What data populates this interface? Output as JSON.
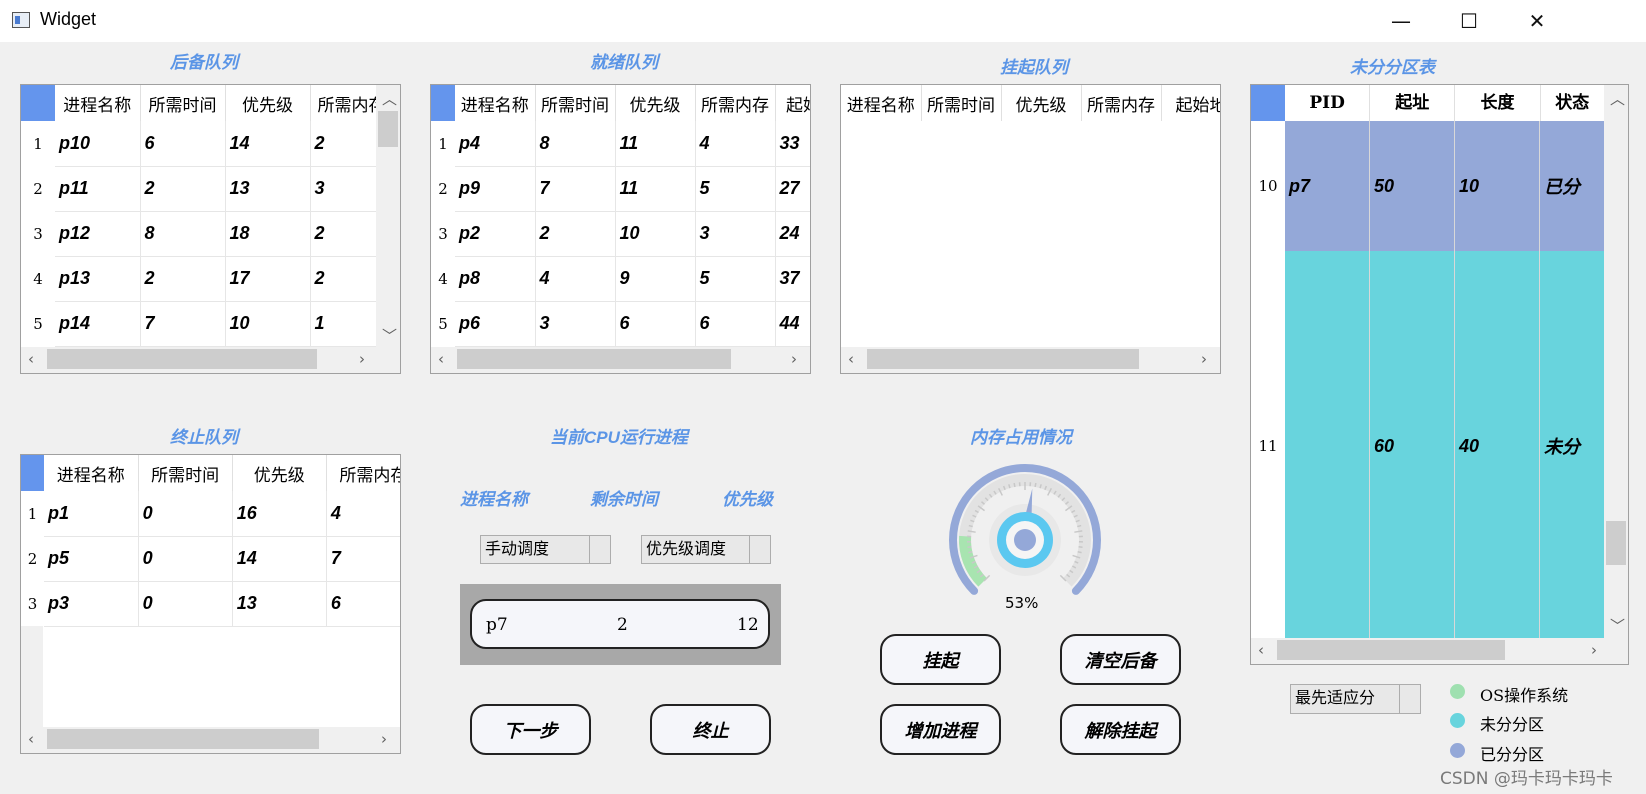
{
  "window": {
    "title": "Widget",
    "minimize": "—",
    "maximize": "☐",
    "close": "✕"
  },
  "labels": {
    "backup_queue": "后备队列",
    "ready_queue": "就绪队列",
    "suspend_queue": "挂起队列",
    "partition_table": "未分分区表",
    "terminated_queue": "终止队列",
    "cpu_process": "当前CPU运行进程",
    "memory_usage": "内存占用情况",
    "col_name": "进程名称",
    "col_remaining": "剩余时间",
    "col_priority": "优先级"
  },
  "backup_table": {
    "headers": [
      "进程名称",
      "所需时间",
      "优先级",
      "所需内存"
    ],
    "rows": [
      [
        "1",
        "p10",
        "6",
        "14",
        "2"
      ],
      [
        "2",
        "p11",
        "2",
        "13",
        "3"
      ],
      [
        "3",
        "p12",
        "8",
        "18",
        "2"
      ],
      [
        "4",
        "p13",
        "2",
        "17",
        "2"
      ],
      [
        "5",
        "p14",
        "7",
        "10",
        "1"
      ]
    ]
  },
  "ready_table": {
    "headers": [
      "进程名称",
      "所需时间",
      "优先级",
      "所需内存",
      "起始"
    ],
    "rows": [
      [
        "1",
        "p4",
        "8",
        "11",
        "4",
        "33"
      ],
      [
        "2",
        "p9",
        "7",
        "11",
        "5",
        "27"
      ],
      [
        "3",
        "p2",
        "2",
        "10",
        "3",
        "24"
      ],
      [
        "4",
        "p8",
        "4",
        "9",
        "5",
        "37"
      ],
      [
        "5",
        "p6",
        "3",
        "6",
        "6",
        "44"
      ]
    ]
  },
  "suspend_table": {
    "headers": [
      "进程名称",
      "所需时间",
      "优先级",
      "所需内存",
      "起始地"
    ],
    "rows": []
  },
  "partition_table": {
    "headers": [
      "PID",
      "起址",
      "长度",
      "状态"
    ],
    "rows": [
      {
        "row": "10",
        "pid": "p7",
        "start": "50",
        "length": "10",
        "status": "已分",
        "color": "#94a8d8"
      },
      {
        "row": "11",
        "pid": "",
        "start": "60",
        "length": "40",
        "status": "未分",
        "color": "#68d4dd"
      }
    ]
  },
  "terminated_table": {
    "headers": [
      "进程名称",
      "所需时间",
      "优先级",
      "所需内存"
    ],
    "rows": [
      [
        "1",
        "p1",
        "0",
        "16",
        "4"
      ],
      [
        "2",
        "p5",
        "0",
        "14",
        "7"
      ],
      [
        "3",
        "p3",
        "0",
        "13",
        "6"
      ]
    ]
  },
  "schedule": {
    "mode": "手动调度",
    "policy": "优先级调度"
  },
  "cpu": {
    "name": "p7",
    "remaining": "2",
    "priority": "12"
  },
  "gauge": {
    "percent_label": "53%",
    "value": 53
  },
  "buttons": {
    "next": "下一步",
    "terminate": "终止",
    "suspend": "挂起",
    "clear_backup": "清空后备",
    "add_process": "增加进程",
    "resume": "解除挂起"
  },
  "alloc_algorithm": "最先适应分",
  "legend": [
    {
      "label": "OS操作系统",
      "color": "#9fe0b0"
    },
    {
      "label": "未分分区",
      "color": "#68d4dd"
    },
    {
      "label": "已分分区",
      "color": "#94a8d8"
    }
  ],
  "watermark": "CSDN @玛卡玛卡玛卡"
}
